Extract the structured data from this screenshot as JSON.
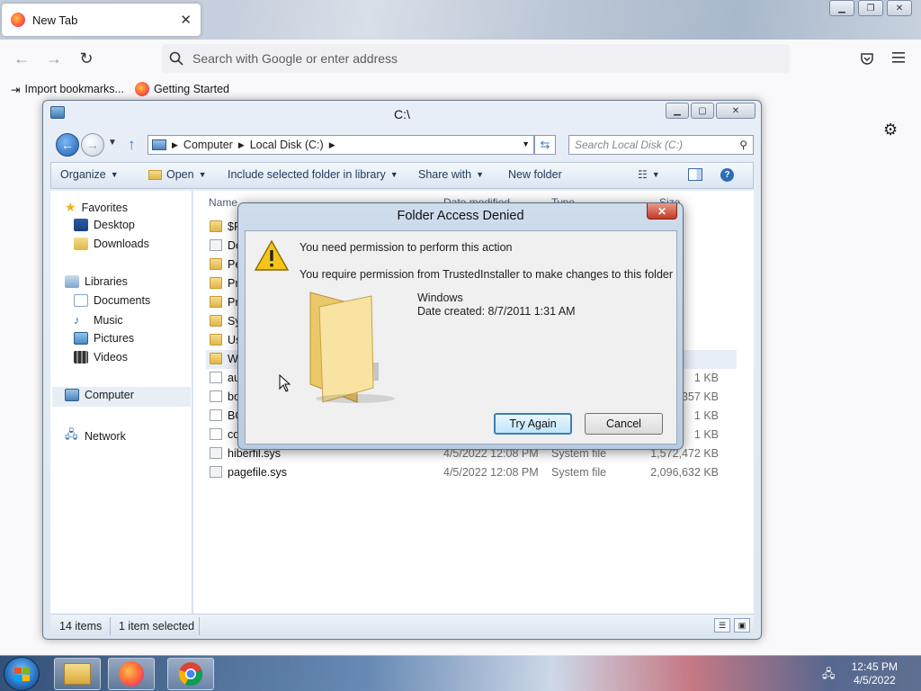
{
  "firefox": {
    "tab_title": "New Tab",
    "tab_close": "✕",
    "url_placeholder": "Search with Google or enter address",
    "bookmarks": [
      "Import bookmarks...",
      "Getting Started"
    ]
  },
  "explorer": {
    "title": "C:\\",
    "breadcrumb": [
      "Computer",
      "Local Disk (C:)"
    ],
    "search_placeholder": "Search Local Disk (C:)",
    "toolbar": {
      "organize": "Organize",
      "open": "Open",
      "include": "Include selected folder in library",
      "share": "Share with",
      "new_folder": "New folder"
    },
    "nav": {
      "favorites": "Favorites",
      "desktop": "Desktop",
      "downloads": "Downloads",
      "libraries": "Libraries",
      "documents": "Documents",
      "music": "Music",
      "pictures": "Pictures",
      "videos": "Videos",
      "computer": "Computer",
      "network": "Network"
    },
    "columns": {
      "name": "Name",
      "date": "Date modified",
      "type": "Type",
      "size": "Size"
    },
    "files": [
      {
        "name": "$R",
        "date": "",
        "type": "",
        "size": ""
      },
      {
        "name": "Do",
        "date": "",
        "type": "",
        "size": ""
      },
      {
        "name": "Pe",
        "date": "",
        "type": "",
        "size": ""
      },
      {
        "name": "Pr",
        "date": "",
        "type": "",
        "size": ""
      },
      {
        "name": "Pr",
        "date": "",
        "type": "",
        "size": ""
      },
      {
        "name": "Sy",
        "date": "",
        "type": "",
        "size": ""
      },
      {
        "name": "Us",
        "date": "",
        "type": "",
        "size": ""
      },
      {
        "name": "W",
        "date": "",
        "type": "",
        "size": ""
      },
      {
        "name": "au",
        "date": "",
        "type": "",
        "size": "1 KB"
      },
      {
        "name": "bo",
        "date": "",
        "type": "",
        "size": "357 KB"
      },
      {
        "name": "BO",
        "date": "",
        "type": "",
        "size": "1 KB"
      },
      {
        "name": "co",
        "date": "",
        "type": "",
        "size": "1 KB"
      },
      {
        "name": "hiberfil.sys",
        "date": "4/5/2022 12:08 PM",
        "type": "System file",
        "size": "1,572,472 KB"
      },
      {
        "name": "pagefile.sys",
        "date": "4/5/2022 12:08 PM",
        "type": "System file",
        "size": "2,096,632 KB"
      }
    ],
    "status": {
      "items": "14 items",
      "selected": "1 item selected"
    }
  },
  "dialog": {
    "title": "Folder Access Denied",
    "close": "✕",
    "message1": "You need permission to perform this action",
    "message2": "You require permission from TrustedInstaller to make changes to this folder",
    "folder_name": "Windows",
    "date_created": "Date created: 8/7/2011 1:31 AM",
    "try_again": "Try Again",
    "cancel": "Cancel"
  },
  "taskbar": {
    "time": "12:45 PM",
    "date": "4/5/2022"
  }
}
